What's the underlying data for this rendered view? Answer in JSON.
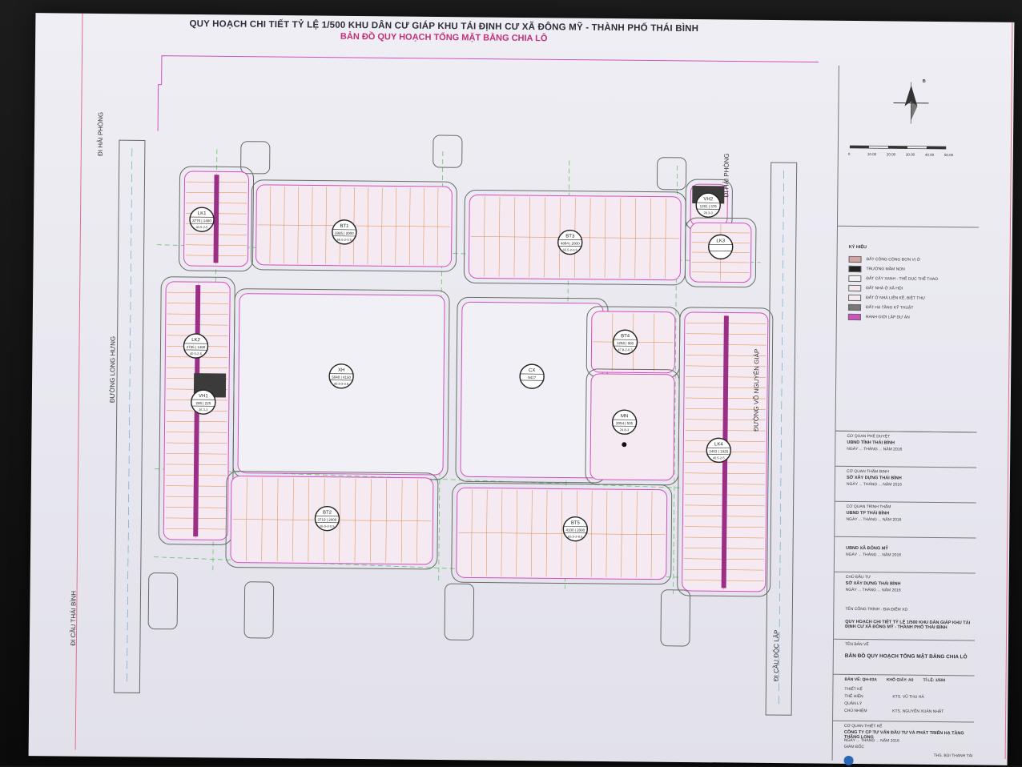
{
  "header": {
    "title_line1": "QUY HOẠCH CHI TIẾT TỶ LỆ 1/500 KHU DÂN CƯ GIÁP KHU TÁI ĐỊNH CƯ XÃ ĐÔNG MỸ - THÀNH PHỐ THÁI BÌNH",
    "title_line2": "BẢN ĐỒ QUY HOẠCH TỔNG MẶT BẰNG CHIA LÔ"
  },
  "colors": {
    "boundary": "#d24fbf",
    "road_edge": "#6a6a6a",
    "lot_line": "#d98840",
    "green_axis": "#69c06a",
    "lot_spine": "#9b2f86",
    "technical": "#3b3b3b",
    "title_pink": "#c2307a"
  },
  "road_labels": {
    "hai_phong_left": "ĐI HẢI PHÒNG",
    "long_hung": "ĐƯỜNG LONG HƯNG",
    "cau_thai_binh": "ĐI CẦU THÁI BÌNH",
    "hai_phong_right": "ĐI HẢI PHÒNG",
    "vo_nguyen_giap": "ĐƯỜNG VÕ NGUYÊN GIÁP",
    "cau_doc_lap": "ĐI CẦU ĐỘC LẬP"
  },
  "blocks": [
    {
      "code": "LK1",
      "a": "3770",
      "b": "1480",
      "c": "40.5-2-5",
      "marker": "l"
    },
    {
      "code": "BT1",
      "a": "2885",
      "b": "2000",
      "c": "65.5-2-0.5",
      "marker": "l"
    },
    {
      "code": "BT3",
      "a": "4864",
      "b": "2000",
      "c": "65.5-2-0.5",
      "marker": "l"
    },
    {
      "code": "VH2",
      "a": "1281",
      "b": "376",
      "c": "29.3-3",
      "marker": "l"
    },
    {
      "code": "LK3",
      "a": "",
      "b": "",
      "c": "",
      "marker": "l"
    },
    {
      "code": "LK2",
      "a": "2735",
      "b": "1480",
      "c": "40.5-2-5",
      "marker": "l"
    },
    {
      "code": "VH1",
      "a": "285",
      "b": "225",
      "c": "26.3-3",
      "marker": "l"
    },
    {
      "code": "XH",
      "a": "5040",
      "b": "4150",
      "c": "40.5-2-0.5",
      "marker": "l"
    },
    {
      "code": "CX",
      "a": "9417",
      "b": "",
      "c": "",
      "marker": "l"
    },
    {
      "code": "BT4",
      "a": "1256",
      "b": "980",
      "c": "47.8-2-0.3",
      "marker": "l"
    },
    {
      "code": "MN",
      "a": "2054",
      "b": "505",
      "c": "24.8-3",
      "marker": "l"
    },
    {
      "code": "LK4",
      "a": "2453",
      "b": "1925",
      "c": "40.5-2-5",
      "marker": "l"
    },
    {
      "code": "BT2",
      "a": "3719",
      "b": "2000",
      "c": "65.5-2-0.5",
      "marker": "l"
    },
    {
      "code": "BT5",
      "a": "4100",
      "b": "2000",
      "c": "65.5-2-0.5",
      "marker": "l"
    }
  ],
  "panel": {
    "north": "B",
    "scale_labels": [
      "0",
      "10.00",
      "20.00",
      "30.00",
      "40.00",
      "50.00"
    ],
    "legend_title": "KÝ HIỆU",
    "legend": [
      {
        "label": "ĐẤT CÔNG CỘNG ĐƠN VỊ Ở",
        "color": "#d6a3a3"
      },
      {
        "label": "TRƯỜNG MẦM NON",
        "color": "#222222"
      },
      {
        "label": "ĐẤT CÂY XANH - THỂ DỤC THỂ THAO",
        "color": "#f1f1f1"
      },
      {
        "label": "ĐẤT NHÀ Ở XÃ HỘI",
        "color": "#f4e8ee"
      },
      {
        "label": "ĐẤT Ở NHÀ LIỀN KỀ, BIỆT THỰ",
        "color": "#f6e9ef"
      },
      {
        "label": "ĐẤT HẠ TẦNG KỸ THUẬT",
        "color": "#777777"
      },
      {
        "label": "RANH GIỚI LẬP DỰ ÁN",
        "color": "#d24fbf"
      }
    ],
    "approvals": [
      {
        "heading": "CƠ QUAN PHÊ DUYỆT",
        "org": "UBND TỈNH THÁI BÌNH",
        "date": "NGÀY ... THÁNG ... NĂM 2016"
      },
      {
        "heading": "CƠ QUAN THẨM ĐỊNH",
        "org": "SỞ XÂY DỰNG THÁI BÌNH",
        "date": "NGÀY ... THÁNG ... NĂM 2016"
      },
      {
        "heading": "CƠ QUAN TRÌNH THẨM",
        "org": "UBND TP THÁI BÌNH",
        "date": "NGÀY ... THÁNG ... NĂM 2016"
      },
      {
        "heading": "",
        "org": "UBND XÃ ĐÔNG MỸ",
        "date": "NGÀY ... THÁNG ... NĂM 2016"
      },
      {
        "heading": "CHỦ ĐẦU TƯ",
        "org": "SỞ XÂY DỰNG THÁI BÌNH",
        "date": "NGÀY ... THÁNG ... NĂM 2016"
      }
    ],
    "project_heading": "TÊN CÔNG TRÌNH - ĐỊA ĐIỂM XD",
    "project_name": "QUY HOẠCH CHI TIẾT TỶ LỆ 1/500 KHU DÂN GIÁP KHU TÁI ĐỊNH CƯ XÃ ĐÔNG MỸ - THÀNH PHỐ THÁI BÌNH",
    "drawing_heading": "TÊN BẢN VẼ",
    "drawing_name": "BẢN ĐỒ QUY HOẠCH TỔNG MẶT BẰNG CHIA LÔ",
    "sheet_info": [
      "BẢN VẼ: QH-03A",
      "KHỔ GIẤY: A0",
      "TỈ LỆ: 1/500"
    ],
    "roles": [
      {
        "role": "THIẾT KẾ",
        "name": ""
      },
      {
        "role": "THỂ HIỆN",
        "name": "KTS. VŨ THU HÀ"
      },
      {
        "role": "QUẢN LÝ",
        "name": ""
      },
      {
        "role": "CHỦ NHIỆM",
        "name": "KTS. NGUYỄN XUÂN NHẬT"
      }
    ],
    "design_heading": "CƠ QUAN THIẾT KẾ",
    "design_org": "CÔNG TY CP TƯ VẤN ĐẦU TƯ VÀ PHÁT TRIỂN HẠ TẦNG THĂNG LONG",
    "design_date": "NGÀY ... THÁNG ... NĂM 2016",
    "director": "GIÁM ĐỐC",
    "footer": "THS. BÙI THANH TÀI"
  }
}
